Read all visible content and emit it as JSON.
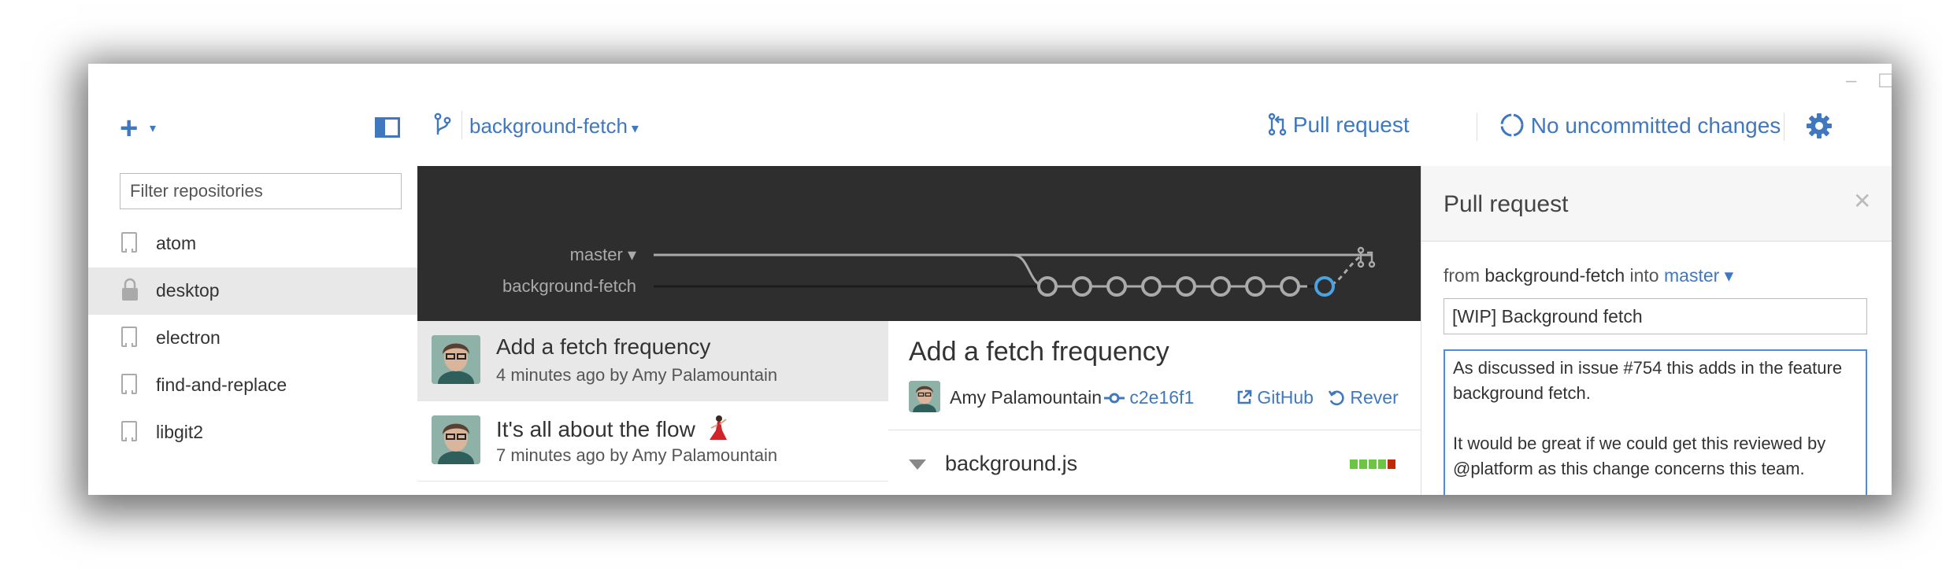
{
  "sidebar": {
    "filter_placeholder": "Filter repositories",
    "repos": [
      {
        "label": "atom",
        "icon": "repo-icon",
        "selected": false
      },
      {
        "label": "desktop",
        "icon": "lock-icon",
        "selected": true
      },
      {
        "label": "electron",
        "icon": "repo-icon",
        "selected": false
      },
      {
        "label": "find-and-replace",
        "icon": "repo-icon",
        "selected": false
      },
      {
        "label": "libgit2",
        "icon": "repo-icon",
        "selected": false
      }
    ]
  },
  "topbar": {
    "branch_label": "background-fetch",
    "pull_request_label": "Pull request",
    "changes_label": "No uncommitted changes"
  },
  "graph": {
    "master_label": "master ▾",
    "branch_label": "background-fetch"
  },
  "commits": [
    {
      "title": "Add a fetch frequency",
      "meta": "4 minutes ago by Amy Palamountain",
      "selected": true
    },
    {
      "title": "It's all about the flow",
      "meta": "7 minutes ago by Amy Palamountain",
      "selected": false
    }
  ],
  "detail": {
    "title": "Add a fetch frequency",
    "author": "Amy Palamountain",
    "sha": "c2e16f1",
    "github_label": "GitHub",
    "revert_label": "Rever",
    "file": "background.js"
  },
  "pr_panel": {
    "title": "Pull request",
    "from_word": "from",
    "from_branch": "background-fetch",
    "into_word": "into",
    "into_branch": "master ▾",
    "title_value": "[WIP] Background fetch",
    "body_value": "As discussed in issue #754 this adds in the feature background fetch.\n\nIt would be great if we could get this reviewed by @platform as this change concerns this team."
  },
  "colors": {
    "accent": "#4078c0",
    "graph_bg": "#2e2e2e",
    "selected_row": "#e8e8e8"
  }
}
